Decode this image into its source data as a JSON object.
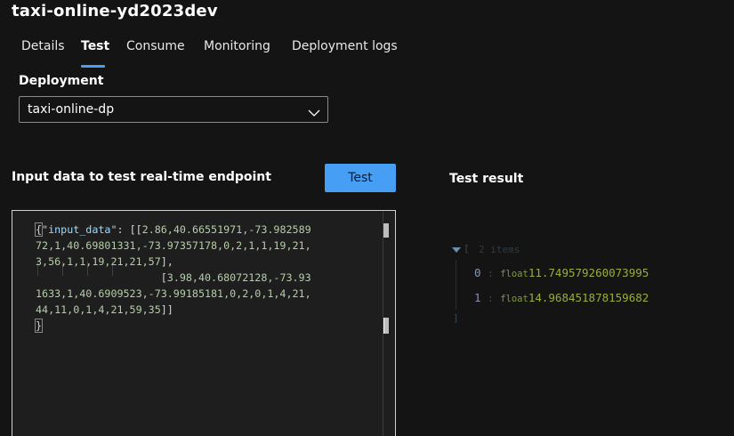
{
  "header": {
    "title": "taxi-online-yd2023dev"
  },
  "tabs": [
    {
      "label": "Details",
      "active": false
    },
    {
      "label": "Test",
      "active": true
    },
    {
      "label": "Consume",
      "active": false
    },
    {
      "label": "Monitoring",
      "active": false
    },
    {
      "label": "Deployment logs",
      "active": false
    }
  ],
  "deployment": {
    "label": "Deployment",
    "selected": "taxi-online-dp"
  },
  "input_panel": {
    "heading": "Input data to test real-time endpoint",
    "test_button": "Test",
    "code": {
      "key": "\"input_data\"",
      "row1": "2.86,40.66551971,-73.98258972,1,40.69801331,-73.97357178,0,2,1,1,19,21,3,56,1,1,19,21,21,57",
      "row2": "3.98,40.68072128,-73.931633,1,40.6909523,-73.99185181,0,2,0,1,4,21,44,11,0,1,4,21,59,35"
    }
  },
  "result_panel": {
    "heading": "Test result",
    "collapsed_count": "2 items",
    "items": [
      {
        "index": "0",
        "type": "float",
        "value": "11.749579260073995"
      },
      {
        "index": "1",
        "type": "float",
        "value": "14.968451878159682"
      }
    ]
  },
  "colors": {
    "accent": "#479ef5",
    "background": "#141414",
    "editor_bg": "#1e1e1e"
  }
}
